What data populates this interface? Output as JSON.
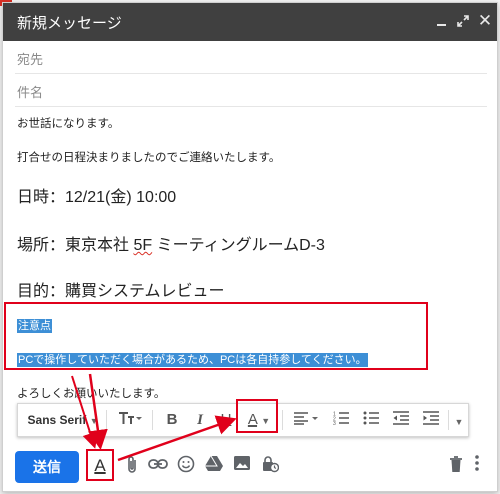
{
  "window": {
    "title": "新規メッセージ",
    "controls": [
      "minimize-icon",
      "expand-icon",
      "close-icon"
    ]
  },
  "fields": {
    "to_placeholder": "宛先",
    "subject_placeholder": "件名"
  },
  "body": {
    "greeting": "お世話になります。",
    "intro": "打合せの日程決まりましたのでご連絡いたします。",
    "date_line": "日時：12/21(金) 10:00",
    "place_prefix": "場所：東京本社 ",
    "place_floor": "5F",
    "place_suffix": " ミーティングルームD-3",
    "purpose_line": "目的：購買システムレビュー",
    "note_title": "注意点",
    "note_text": "PCで操作していただく場合があるため、PCは各自持参してください。",
    "closing": "よろしくお願いいたします。"
  },
  "format_toolbar": {
    "font_family": "Sans Serif",
    "font_size_icon": "text-size-icon",
    "bold_label": "B",
    "italic_label": "I",
    "underline_label": "U",
    "text_color_label": "A",
    "align_icon": "align-left-icon",
    "numbered_list_icon": "numbered-list-icon",
    "bulleted_list_icon": "bulleted-list-icon",
    "indent_less_icon": "indent-less-icon",
    "indent_more_icon": "indent-more-icon",
    "more_icon": "more-formatting-icon"
  },
  "bottom_bar": {
    "send_label": "送信",
    "formatting_toggle_label": "A",
    "icons": [
      "attach-icon",
      "link-icon",
      "emoji-icon",
      "drive-icon",
      "photo-icon",
      "confidential-icon",
      "trash-icon",
      "more-options-icon"
    ]
  },
  "colors": {
    "header_bg": "#404040",
    "send_button": "#1a73e8",
    "selection": "#3d8fd6",
    "annotation_red": "#e0001b"
  }
}
